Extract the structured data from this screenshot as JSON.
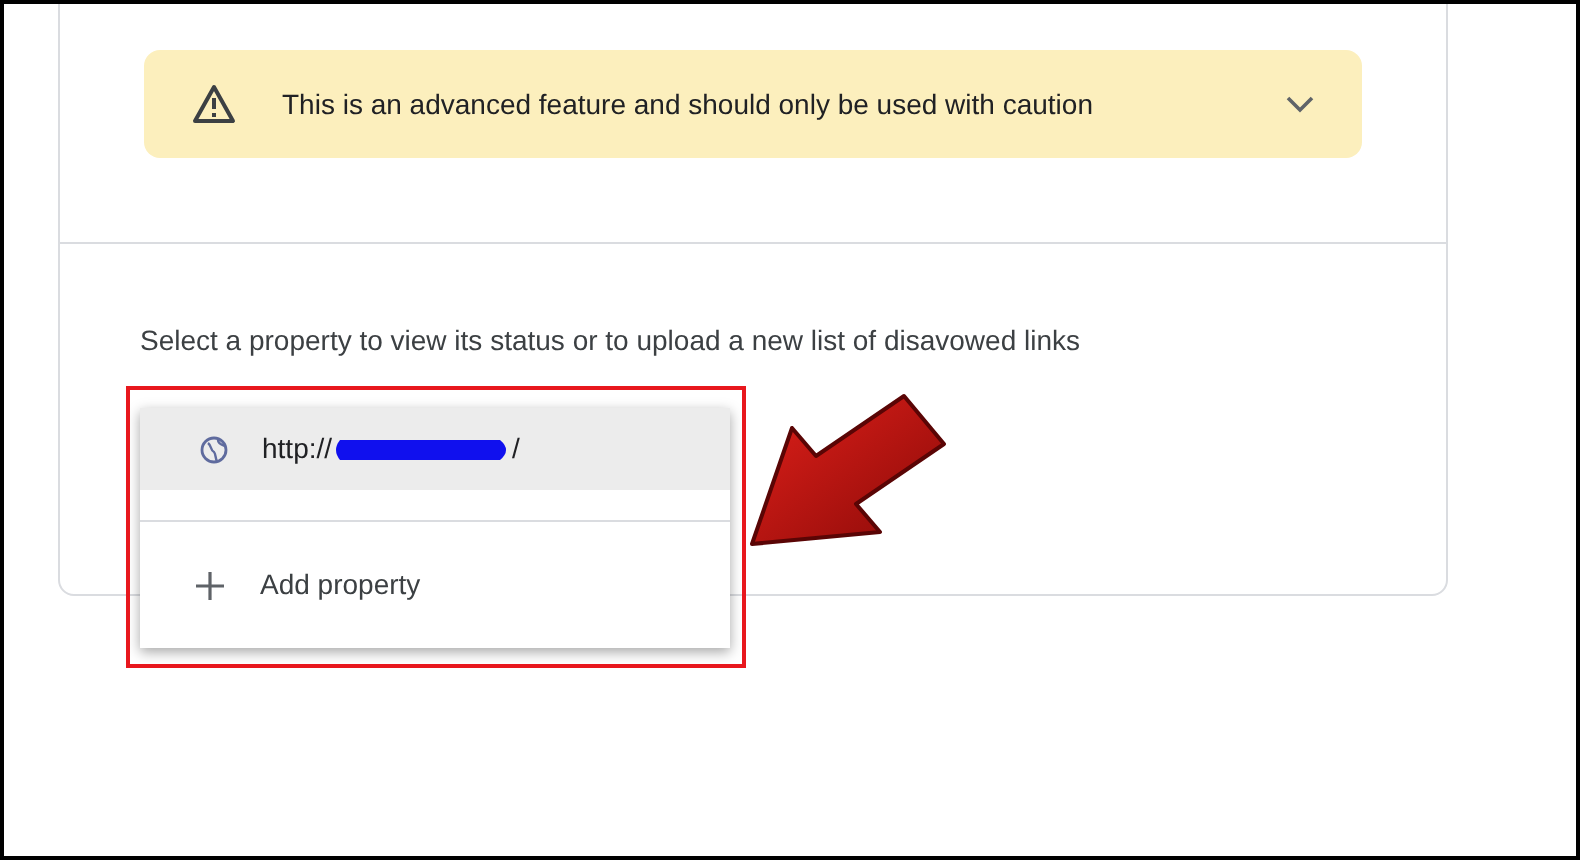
{
  "warning": {
    "text": "This is an advanced feature and should only be used with caution",
    "expanded": false
  },
  "instruction": "Select a property to view its status or to upload a new list of disavowed links",
  "menu": [
    {
      "kind": "property",
      "prefix": "http://",
      "suffix": "/",
      "selected": true
    },
    {
      "kind": "add",
      "label": "Add property",
      "selected": false
    }
  ]
}
